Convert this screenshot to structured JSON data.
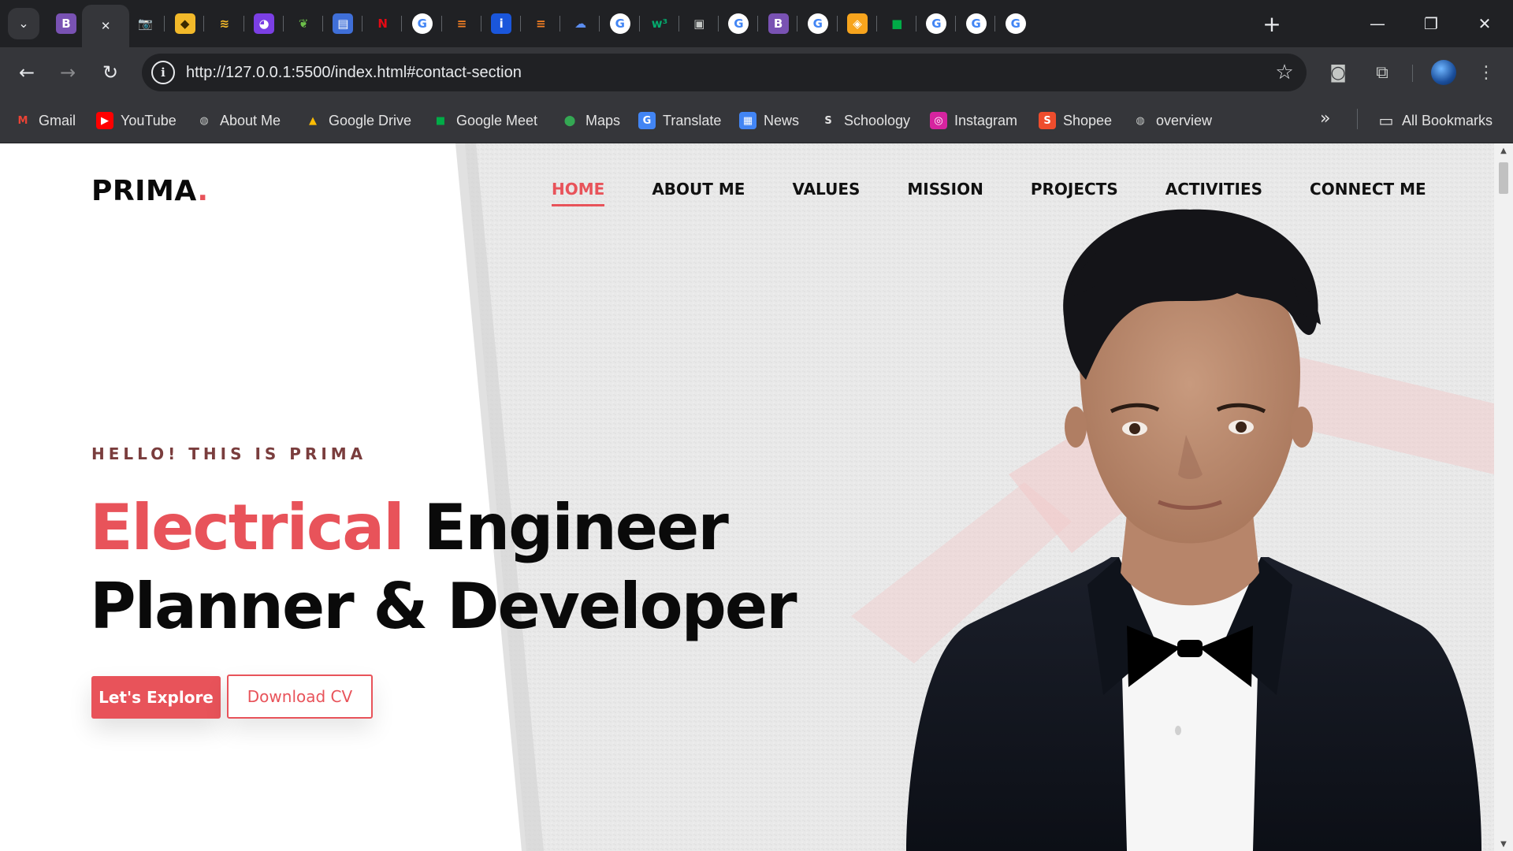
{
  "browser": {
    "tabs": [
      {
        "name": "tab-bootstrap",
        "icon": "bootstrap-icon",
        "glyph": "B",
        "bg": "#7952b3",
        "color": "#ffffff",
        "active": false
      },
      {
        "name": "tab-active",
        "icon": "close-icon",
        "glyph": "✕",
        "bg": "transparent",
        "color": "#e8eaed",
        "active": true
      },
      {
        "name": "tab-camera",
        "icon": "camera-icon",
        "glyph": "📷",
        "bg": "transparent",
        "color": "#c4c7c5",
        "active": false
      },
      {
        "name": "tab-layers-yellow",
        "icon": "layers-icon",
        "glyph": "◆",
        "bg": "#f2b92a",
        "color": "#3a2a00",
        "active": false
      },
      {
        "name": "tab-stack",
        "icon": "stack-icon",
        "glyph": "≋",
        "bg": "transparent",
        "color": "#f2b92a",
        "active": false
      },
      {
        "name": "tab-pie",
        "icon": "pie-chart-icon",
        "glyph": "◕",
        "bg": "#7b3fe4",
        "color": "#ffffff",
        "active": false
      },
      {
        "name": "tab-leaf",
        "icon": "leaf-icon",
        "glyph": "❦",
        "bg": "transparent",
        "color": "#6cc04a",
        "active": false
      },
      {
        "name": "tab-layout",
        "icon": "layout-icon",
        "glyph": "▤",
        "bg": "#3f6fd8",
        "color": "#ffffff",
        "active": false
      },
      {
        "name": "tab-netflix",
        "icon": "netflix-icon",
        "glyph": "N",
        "bg": "transparent",
        "color": "#e50914",
        "active": false
      },
      {
        "name": "tab-google-1",
        "icon": "google-icon",
        "glyph": "G",
        "bg": "#ffffff",
        "color": "#4285f4",
        "active": false
      },
      {
        "name": "tab-stackoverflow-1",
        "icon": "stackoverflow-icon",
        "glyph": "≡",
        "bg": "transparent",
        "color": "#f48024",
        "active": false
      },
      {
        "name": "tab-info",
        "icon": "info-icon",
        "glyph": "i",
        "bg": "#1a56db",
        "color": "#ffffff",
        "active": false
      },
      {
        "name": "tab-stackoverflow-2",
        "icon": "stackoverflow-icon",
        "glyph": "≡",
        "bg": "transparent",
        "color": "#f48024",
        "active": false
      },
      {
        "name": "tab-fingerprint",
        "icon": "fingerprint-icon",
        "glyph": "☁",
        "bg": "transparent",
        "color": "#5b8def",
        "active": false
      },
      {
        "name": "tab-google-2",
        "icon": "google-icon",
        "glyph": "G",
        "bg": "#ffffff",
        "color": "#4285f4",
        "active": false
      },
      {
        "name": "tab-w3schools",
        "icon": "w3schools-icon",
        "glyph": "w³",
        "bg": "transparent",
        "color": "#04aa6d",
        "active": false
      },
      {
        "name": "tab-contact",
        "icon": "contact-card-icon",
        "glyph": "▣",
        "bg": "transparent",
        "color": "#c4c7c5",
        "active": false
      },
      {
        "name": "tab-google-3",
        "icon": "google-icon",
        "glyph": "G",
        "bg": "#ffffff",
        "color": "#4285f4",
        "active": false
      },
      {
        "name": "tab-bootstrap-2",
        "icon": "bootstrap-icon",
        "glyph": "B",
        "bg": "#7952b3",
        "color": "#ffffff",
        "active": false
      },
      {
        "name": "tab-google-4",
        "icon": "google-icon",
        "glyph": "G",
        "bg": "#ffffff",
        "color": "#4285f4",
        "active": false
      },
      {
        "name": "tab-ticket",
        "icon": "ticket-icon",
        "glyph": "◈",
        "bg": "#f7a41d",
        "color": "#ffffff",
        "active": false
      },
      {
        "name": "tab-meet",
        "icon": "google-meet-icon",
        "glyph": "■",
        "bg": "transparent",
        "color": "#00ac47",
        "active": false
      },
      {
        "name": "tab-google-5",
        "icon": "google-icon",
        "glyph": "G",
        "bg": "#ffffff",
        "color": "#4285f4",
        "active": false
      },
      {
        "name": "tab-google-6",
        "icon": "google-icon",
        "glyph": "G",
        "bg": "#ffffff",
        "color": "#4285f4",
        "active": false
      },
      {
        "name": "tab-google-7",
        "icon": "google-icon",
        "glyph": "G",
        "bg": "#ffffff",
        "color": "#4285f4",
        "active": false
      }
    ],
    "new_tab_glyph": "+",
    "window": {
      "minimize": "—",
      "restore": "❐",
      "close": "✕"
    },
    "nav": {
      "back": "←",
      "forward": "→",
      "reload": "↻"
    },
    "url": "http://127.0.0.1:5500/index.html#contact-section",
    "info_glyph": "i",
    "star_glyph": "☆",
    "toolbar_icons": {
      "camera": "◙",
      "extensions": "⧉",
      "menu": "⋮"
    },
    "bookmarks": [
      {
        "name": "bookmark-gmail",
        "icon": "gmail-icon",
        "glyph": "M",
        "bg": "transparent",
        "color": "#ea4335",
        "label": "Gmail"
      },
      {
        "name": "bookmark-youtube",
        "icon": "youtube-icon",
        "glyph": "▶",
        "bg": "#ff0000",
        "color": "#ffffff",
        "label": "YouTube"
      },
      {
        "name": "bookmark-about-me",
        "icon": "globe-icon",
        "glyph": "◍",
        "bg": "transparent",
        "color": "#c4c7c5",
        "label": "About Me"
      },
      {
        "name": "bookmark-google-drive",
        "icon": "google-drive-icon",
        "glyph": "▲",
        "bg": "transparent",
        "color": "#fbbc04",
        "label": "Google Drive"
      },
      {
        "name": "bookmark-google-meet",
        "icon": "google-meet-icon",
        "glyph": "■",
        "bg": "transparent",
        "color": "#00ac47",
        "label": "Google Meet"
      },
      {
        "name": "bookmark-maps",
        "icon": "maps-pin-icon",
        "glyph": "⬤",
        "bg": "transparent",
        "color": "#34a853",
        "label": "Maps"
      },
      {
        "name": "bookmark-translate",
        "icon": "translate-icon",
        "glyph": "G",
        "bg": "#4285f4",
        "color": "#ffffff",
        "label": "Translate"
      },
      {
        "name": "bookmark-news",
        "icon": "news-icon",
        "glyph": "▦",
        "bg": "#4285f4",
        "color": "#ffffff",
        "label": "News"
      },
      {
        "name": "bookmark-schoology",
        "icon": "schoology-icon",
        "glyph": "S",
        "bg": "transparent",
        "color": "#e3e3e3",
        "label": "Schoology"
      },
      {
        "name": "bookmark-instagram",
        "icon": "instagram-icon",
        "glyph": "◎",
        "bg": "#d6249f",
        "color": "#ffffff",
        "label": "Instagram"
      },
      {
        "name": "bookmark-shopee",
        "icon": "shopee-icon",
        "glyph": "S",
        "bg": "#ee4d2d",
        "color": "#ffffff",
        "label": "Shopee"
      },
      {
        "name": "bookmark-overview",
        "icon": "globe-icon",
        "glyph": "◍",
        "bg": "transparent",
        "color": "#c4c7c5",
        "label": "overview"
      }
    ],
    "bookmarks_more": "»",
    "all_bookmarks": {
      "icon": "folder-icon",
      "glyph": "▭",
      "label": "All Bookmarks"
    }
  },
  "site": {
    "logo": {
      "text": "PRIMA",
      "dot": "."
    },
    "nav": [
      {
        "label": "HOME",
        "active": true
      },
      {
        "label": "ABOUT ME",
        "active": false
      },
      {
        "label": "VALUES",
        "active": false
      },
      {
        "label": "MISSION",
        "active": false
      },
      {
        "label": "PROJECTS",
        "active": false
      },
      {
        "label": "ACTIVITIES",
        "active": false
      },
      {
        "label": "CONNECT ME",
        "active": false
      }
    ],
    "greeting": "HELLO! THIS IS PRIMA",
    "headline": {
      "accent": "Electrical",
      "rest_line1": " Engineer",
      "line2": "Planner & Developer"
    },
    "buttons": {
      "explore": "Let's Explore",
      "download_cv": "Download CV"
    }
  },
  "colors": {
    "accent": "#e8535a",
    "browser_bg": "#202124",
    "toolbar_bg": "#35363a"
  }
}
